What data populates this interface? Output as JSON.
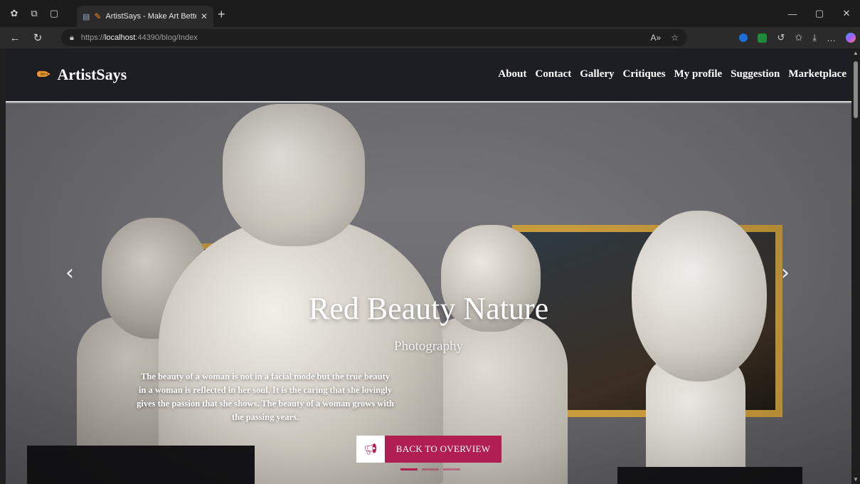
{
  "browser": {
    "tab_title": "ArtistSays - Make Art Better",
    "url_prefix": "https://",
    "url_host": "localhost",
    "url_rest": ":44390/blog/Index"
  },
  "site": {
    "brand": "ArtistSays",
    "menu": [
      "About",
      "Contact",
      "Gallery",
      "Critiques",
      "My profile",
      "Suggestion",
      "Marketplace"
    ]
  },
  "hero": {
    "title": "Red Beauty Nature",
    "subtitle": "Photography",
    "text": "The beauty of a woman is not in a facial mode but the true beauty in a woman is reflected in her soul. It is the caring that she lovingly gives the passion that she shows. The beauty of a woman grows with the passing years.",
    "button_label": "BACK TO OVERVIEW",
    "slide_count": 3,
    "active_slide": 1
  },
  "colors": {
    "accent": "#b01e52",
    "header_bg": "#1d1d24",
    "brand_icon": "#f29a2e"
  },
  "icons": {
    "brand": "pencil-icon",
    "button": "megaphone-icon"
  }
}
